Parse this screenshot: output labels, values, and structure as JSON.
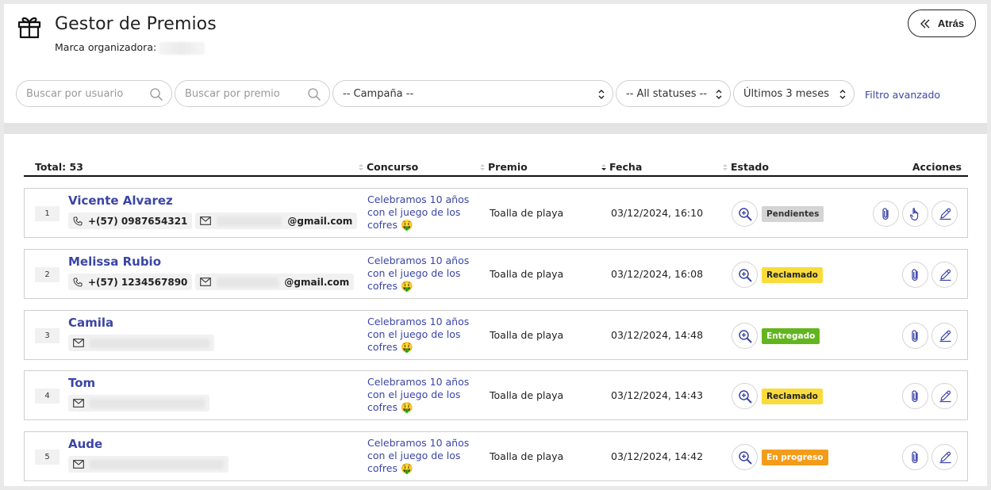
{
  "header": {
    "title": "Gestor de Premios",
    "brand_label": "Marca organizadora:",
    "back_label": "Atrás"
  },
  "filters": {
    "user_search_placeholder": "Buscar por usuario",
    "prize_search_placeholder": "Buscar por premio",
    "campaign": "-- Campaña --",
    "status": "-- All statuses --",
    "period": "Últimos 3 meses",
    "advanced": "Filtro avanzado"
  },
  "table": {
    "total": "Total: 53",
    "col_concurso": "Concurso",
    "col_premio": "Premio",
    "col_fecha": "Fecha",
    "col_estado": "Estado",
    "col_acciones": "Acciones"
  },
  "rows": [
    {
      "index": "1",
      "name": "Vicente Alvarez",
      "phone": "+(57) 0987654321",
      "email": "@gmail.com",
      "concurso": "Celebramos 10 años con el juego de los cofres 🤑",
      "premio": "Toalla de playa",
      "fecha": "03/12/2024, 16:10",
      "estado": "Pendientes",
      "estado_bg": "#d4d4d4",
      "estado_fg": "#333333"
    },
    {
      "index": "2",
      "name": "Melissa Rubio",
      "phone": "+(57) 1234567890",
      "email": "@gmail.com",
      "concurso": "Celebramos 10 años con el juego de los cofres 🤑",
      "premio": "Toalla de playa",
      "fecha": "03/12/2024, 16:08",
      "estado": "Reclamado",
      "estado_bg": "#f9dc3c",
      "estado_fg": "#222222"
    },
    {
      "index": "3",
      "name": "Camila",
      "concurso": "Celebramos 10 años con el juego de los cofres 🤑",
      "premio": "Toalla de playa",
      "fecha": "03/12/2024, 14:48",
      "estado": "Entregado",
      "estado_bg": "#63b51f",
      "estado_fg": "#ffffff"
    },
    {
      "index": "4",
      "name": "Tom",
      "concurso": "Celebramos 10 años con el juego de los cofres 🤑",
      "premio": "Toalla de playa",
      "fecha": "03/12/2024, 14:43",
      "estado": "Reclamado",
      "estado_bg": "#f9dc3c",
      "estado_fg": "#222222"
    },
    {
      "index": "5",
      "name": "Aude",
      "concurso": "Celebramos 10 años con el juego de los cofres 🤑",
      "premio": "Toalla de playa",
      "fecha": "03/12/2024, 14:42",
      "estado": "En progreso",
      "estado_bg": "#f39c1a",
      "estado_fg": "#ffffff"
    }
  ],
  "icons": {
    "gift": "gift-icon",
    "back": "double-chevron-left-icon",
    "search": "search-icon",
    "phone": "phone-icon",
    "mail": "mail-icon",
    "zoom": "zoom-in-icon",
    "attach": "paperclip-icon",
    "hand": "hand-pointer-icon",
    "edit": "pencil-icon"
  },
  "colors": {
    "accent": "#3b45a6"
  }
}
